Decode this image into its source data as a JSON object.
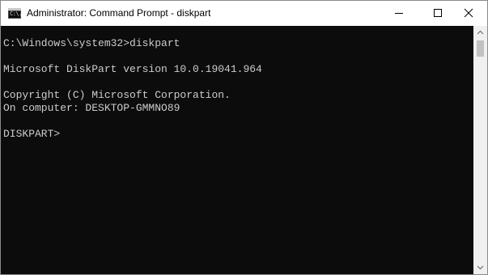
{
  "window": {
    "title": "Administrator: Command Prompt - diskpart",
    "icon": "cmd-icon",
    "icon_glyph": "C:\\."
  },
  "caption_buttons": {
    "minimize_icon": "minimize-icon",
    "maximize_icon": "maximize-icon",
    "close_icon": "close-icon"
  },
  "console": {
    "lines": [
      "C:\\Windows\\system32>diskpart",
      "",
      "Microsoft DiskPart version 10.0.19041.964",
      "",
      "Copyright (C) Microsoft Corporation.",
      "On computer: DESKTOP-GMMNO89",
      "",
      "DISKPART>"
    ]
  },
  "colors": {
    "console_background": "#0c0c0c",
    "console_text": "#cccccc",
    "titlebar_background": "#ffffff",
    "scrollbar_track": "#f0f0f0",
    "scrollbar_thumb": "#c1c1c1"
  }
}
